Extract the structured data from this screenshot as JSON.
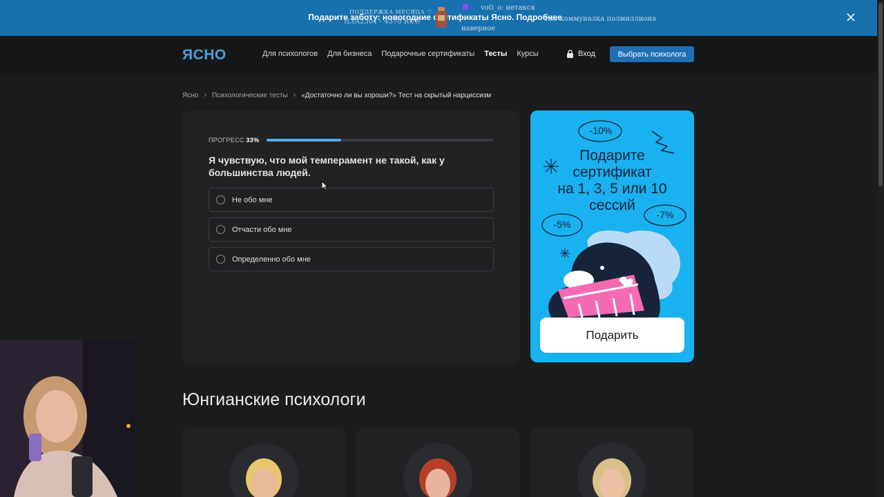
{
  "promo": {
    "text": "Подарите заботу: новогодние сертификаты Ясно. Подробнее"
  },
  "overlay": {
    "support_title": "ПОДДЕРЖКА МЕСЯЦА ♡",
    "donor": "ILYA2301 - 4370 RUB",
    "chat_user": "voti_o: нетакся",
    "chat_line2": "наверное",
    "chat_line3": "там коммуналка полмиллиона"
  },
  "header": {
    "logo": "ЯСНО",
    "nav": [
      "Для психологов",
      "Для бизнеса",
      "Подарочные сертификаты",
      "Тесты",
      "Курсы"
    ],
    "active_nav": "Тесты",
    "login": "Вход",
    "pick_button": "Выбрать психолога"
  },
  "breadcrumbs": [
    "Ясно",
    "Психологические тесты",
    "«Достаточно ли вы хороши?» Тест на скрытый нарциссизм"
  ],
  "test": {
    "progress_label": "ПРОГРЕСС",
    "progress_value": "33%",
    "progress_fraction": 0.33,
    "question": "Я чувствую, что мой темперамент не такой, как у большинства людей.",
    "options": [
      "Не обо мне",
      "Отчасти обо мне",
      "Определенно обо мне"
    ]
  },
  "gift_card": {
    "title_lines": [
      "Подарите",
      "сертификат",
      "на 1, 3, 5 или 10",
      "сессий"
    ],
    "badges": [
      "-10%",
      "-7%",
      "-5%"
    ],
    "button": "Подарить"
  },
  "section": {
    "title": "Юнгианские психологи"
  },
  "colors": {
    "accent": "#1f6fb3",
    "promo_bg": "#1671ae",
    "gift_bg": "#19b1ef",
    "progress": "#5aa9e6"
  }
}
